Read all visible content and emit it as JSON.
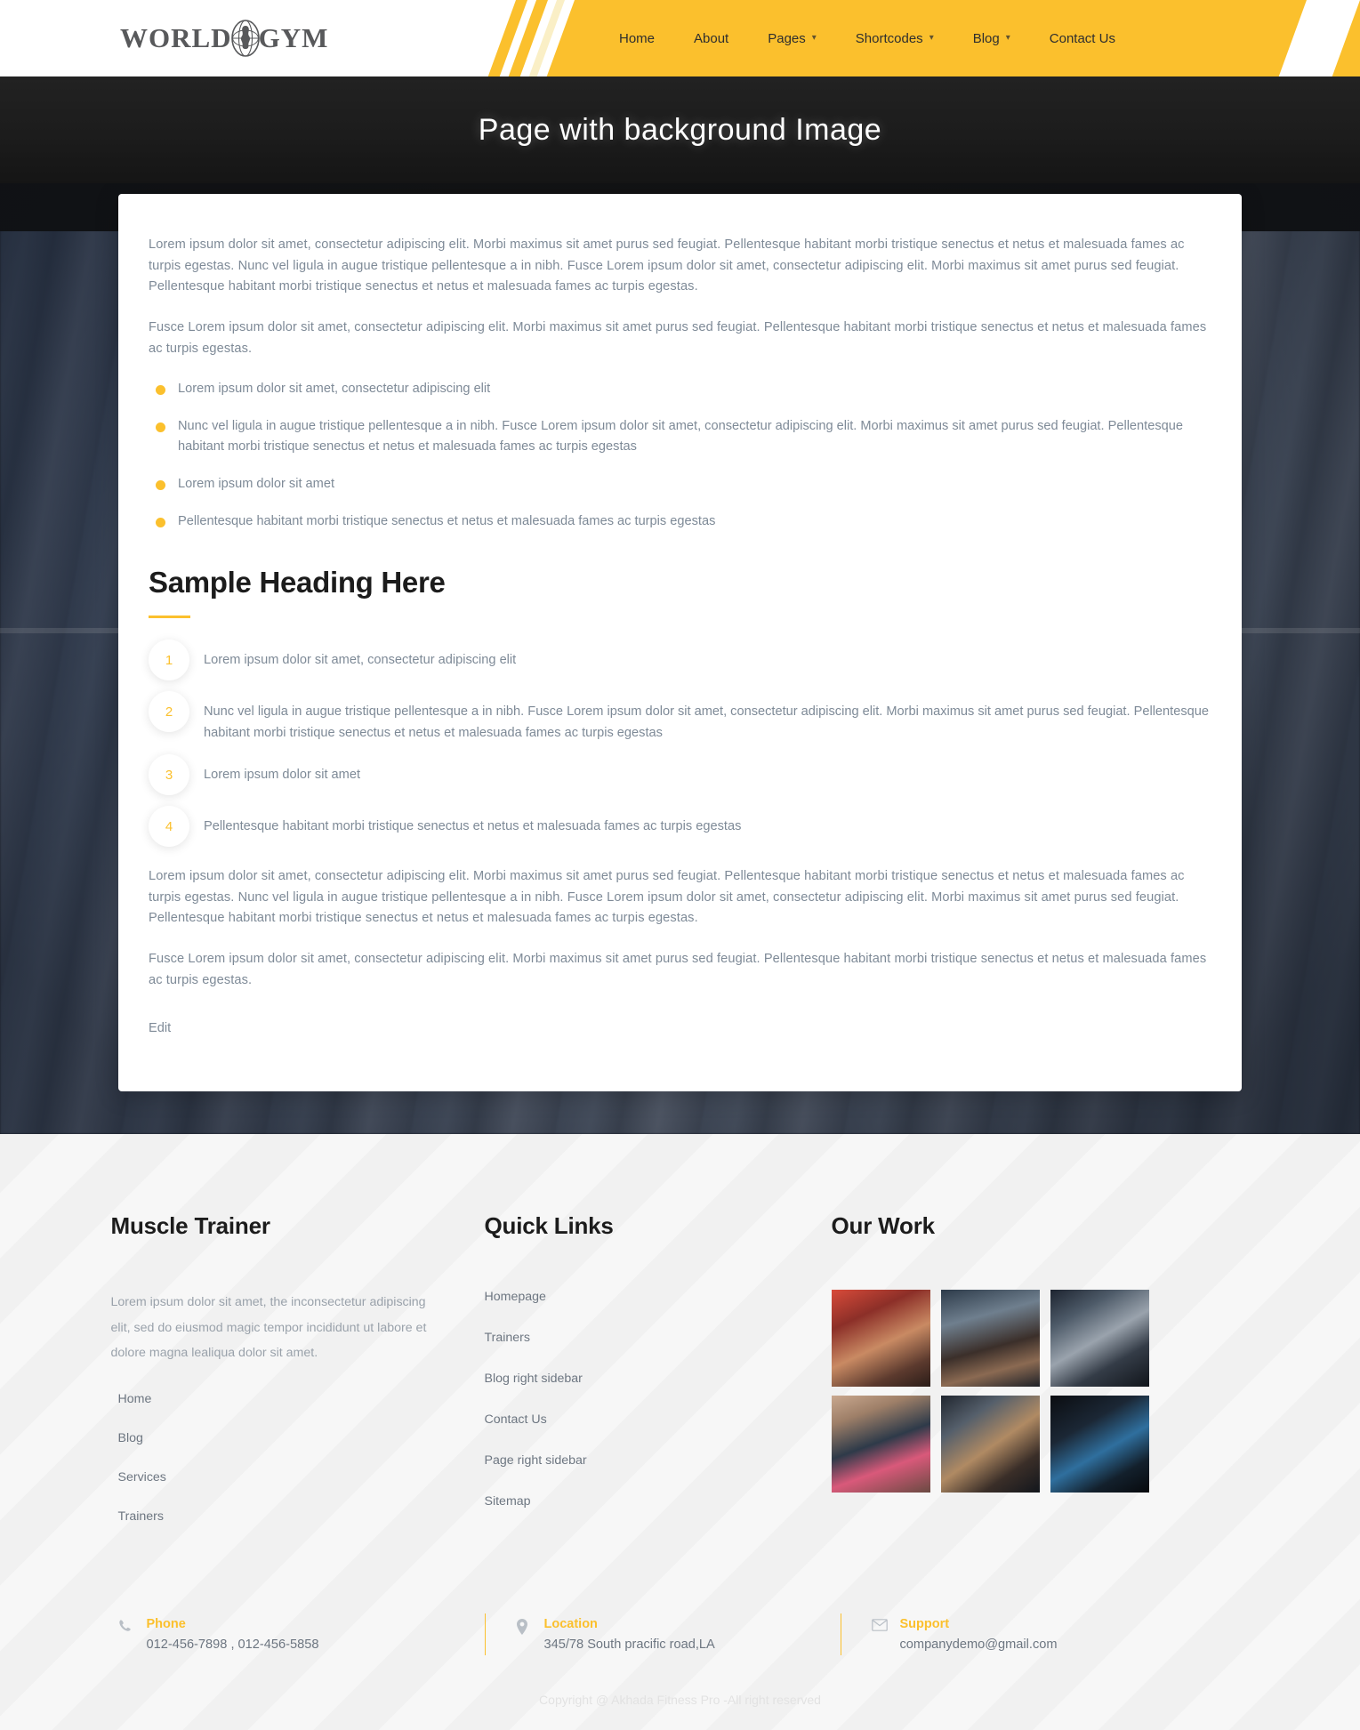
{
  "header": {
    "logo": {
      "word1": "WORLD",
      "word2": "GYM",
      "icon": "globe-icon"
    },
    "nav": [
      {
        "label": "Home",
        "has_caret": false
      },
      {
        "label": "About",
        "has_caret": false
      },
      {
        "label": "Pages",
        "has_caret": true
      },
      {
        "label": "Shortcodes",
        "has_caret": true
      },
      {
        "label": "Blog",
        "has_caret": true
      },
      {
        "label": "Contact Us",
        "has_caret": false
      }
    ],
    "accent_color": "#fbc02d"
  },
  "hero": {
    "title": "Page with background Image"
  },
  "content": {
    "paragraph1": "Lorem ipsum dolor sit amet, consectetur adipiscing elit. Morbi maximus sit amet purus sed feugiat. Pellentesque habitant morbi tristique senectus et netus et malesuada fames ac turpis egestas. Nunc vel ligula in augue tristique pellentesque a in nibh. Fusce Lorem ipsum dolor sit amet, consectetur adipiscing elit. Morbi maximus sit amet purus sed feugiat. Pellentesque habitant morbi tristique senectus et netus et malesuada fames ac turpis egestas.",
    "paragraph2": "Fusce Lorem ipsum dolor sit amet, consectetur adipiscing elit. Morbi maximus sit amet purus sed feugiat. Pellentesque habitant morbi tristique senectus et netus et malesuada fames ac turpis egestas.",
    "bullets": [
      "Lorem ipsum dolor sit amet, consectetur adipiscing elit",
      "Nunc vel ligula in augue tristique pellentesque a in nibh. Fusce Lorem ipsum dolor sit amet, consectetur adipiscing elit. Morbi maximus sit amet purus sed feugiat. Pellentesque habitant morbi tristique senectus et netus et malesuada fames ac turpis egestas",
      "Lorem ipsum dolor sit amet",
      "Pellentesque habitant morbi tristique senectus et netus et malesuada fames ac turpis egestas"
    ],
    "heading": "Sample Heading Here",
    "numbered": [
      {
        "num": "1",
        "text": "Lorem ipsum dolor sit amet, consectetur adipiscing elit"
      },
      {
        "num": "2",
        "text": "Nunc vel ligula in augue tristique pellentesque a in nibh. Fusce Lorem ipsum dolor sit amet, consectetur adipiscing elit. Morbi maximus sit amet purus sed feugiat. Pellentesque habitant morbi tristique senectus et netus et malesuada fames ac turpis egestas"
      },
      {
        "num": "3",
        "text": "Lorem ipsum dolor sit amet"
      },
      {
        "num": "4",
        "text": "Pellentesque habitant morbi tristique senectus et netus et malesuada fames ac turpis egestas"
      }
    ],
    "paragraph3": "Lorem ipsum dolor sit amet, consectetur adipiscing elit. Morbi maximus sit amet purus sed feugiat. Pellentesque habitant morbi tristique senectus et netus et malesuada fames ac turpis egestas. Nunc vel ligula in augue tristique pellentesque a in nibh. Fusce Lorem ipsum dolor sit amet, consectetur adipiscing elit. Morbi maximus sit amet purus sed feugiat. Pellentesque habitant morbi tristique senectus et netus et malesuada fames ac turpis egestas.",
    "paragraph4": "Fusce Lorem ipsum dolor sit amet, consectetur adipiscing elit. Morbi maximus sit amet purus sed feugiat. Pellentesque habitant morbi tristique senectus et netus et malesuada fames ac turpis egestas.",
    "edit_label": "Edit"
  },
  "footer": {
    "about": {
      "title": "Muscle Trainer",
      "description": "Lorem ipsum dolor sit amet, the inconsectetur adipiscing elit, sed do eiusmod magic tempor incididunt ut labore et dolore magna lealiqua dolor sit amet.",
      "links": [
        "Home",
        "Blog",
        "Services",
        "Trainers"
      ]
    },
    "quick_links": {
      "title": "Quick Links",
      "links": [
        "Homepage",
        "Trainers",
        "Blog right sidebar",
        "Contact Us",
        "Page right sidebar",
        "Sitemap"
      ]
    },
    "our_work": {
      "title": "Our Work",
      "thumbs": [
        "gym-women-dumbbells-thumb",
        "gym-back-muscles-thumb",
        "gym-trainer-client-thumb",
        "gym-women-floor-thumb",
        "gym-man-abs-thumb",
        "gym-man-dumbbell-dark-thumb"
      ]
    },
    "contact": [
      {
        "icon": "phone-icon",
        "label": "Phone",
        "value": "012-456-7898 , 012-456-5858"
      },
      {
        "icon": "location-pin-icon",
        "label": "Location",
        "value": "345/78 South pracific road,LA"
      },
      {
        "icon": "envelope-icon",
        "label": "Support",
        "value": "companydemo@gmail.com"
      }
    ],
    "copyright": "Copyright @ Akhada Fitness Pro -All right reserved"
  }
}
